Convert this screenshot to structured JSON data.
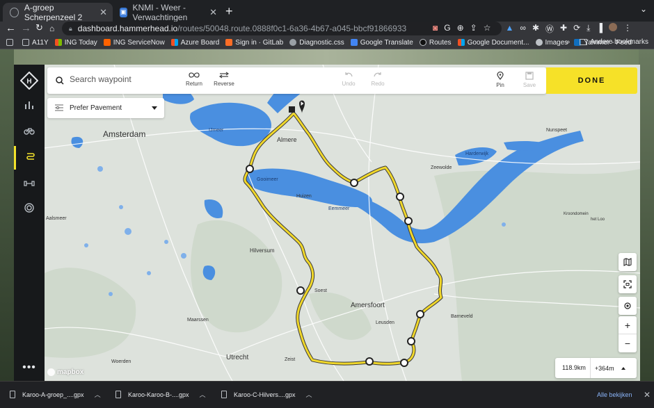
{
  "browser": {
    "tabs": [
      {
        "title": "A-groep Scherpenzeel 2",
        "active": true
      },
      {
        "title": "KNMI - Weer - Verwachtingen",
        "active": false
      }
    ],
    "url_host": "dashboard.hammerhead.io",
    "url_path": "/routes/50048.route.0888f0c1-6a36-4b67-a045-bbcf91866933",
    "bookmarks": [
      "A11Y",
      "ING Today",
      "ING ServiceNow",
      "Azure Board",
      "Sign in · GitLab",
      "Diagnostic.css",
      "Google Translate",
      "Routes",
      "Google Document...",
      "Images",
      "Yammer - Feed"
    ],
    "bookmarks_more": "»",
    "other_bookmarks": "Andere bookmarks"
  },
  "toolbar": {
    "search_placeholder": "Search waypoint",
    "return_label": "Return",
    "reverse_label": "Reverse",
    "undo_label": "Undo",
    "redo_label": "Redo",
    "pin_label": "Pin",
    "save_label": "Save",
    "done_label": "DONE"
  },
  "routing": {
    "preference": "Prefer Pavement"
  },
  "route_stats": {
    "distance": "118.9km",
    "elevation": "+364m"
  },
  "map": {
    "labels": {
      "amsterdam": "Amsterdam",
      "ijmeer": "IJmeer",
      "almere": "Almere",
      "gooimeer": "Gooimeer",
      "eemmeer": "Eemmeer",
      "huizen": "Huizen",
      "hilversum": "Hilversum",
      "soest": "Soest",
      "amersfoort": "Amersfoort",
      "leusden": "Leusden",
      "utrecht": "Utrecht",
      "zeist": "Zeist",
      "woerden": "Woerden",
      "maarssen": "Maarssen",
      "aalsmeer": "Aalsmeer",
      "harderwijk": "Harderwijk",
      "nunspeet": "Nunspeet",
      "zeewolde": "Zeewolde",
      "barneveld": "Barneveld",
      "kroondomein": "Kroondomein",
      "hetloo": "het Loo",
      "mapbox": "mapbox"
    },
    "colors": {
      "land": "#dfe3df",
      "water": "#4a8fe0",
      "route": "#f0d72a",
      "route_outline": "#3a3a3a"
    }
  },
  "downloads": {
    "files": [
      "Karoo-A-groep_....gpx",
      "Karoo-Karoo-B-....gpx",
      "Karoo-C-Hilvers....gpx"
    ],
    "show_all": "Alle bekijken"
  }
}
